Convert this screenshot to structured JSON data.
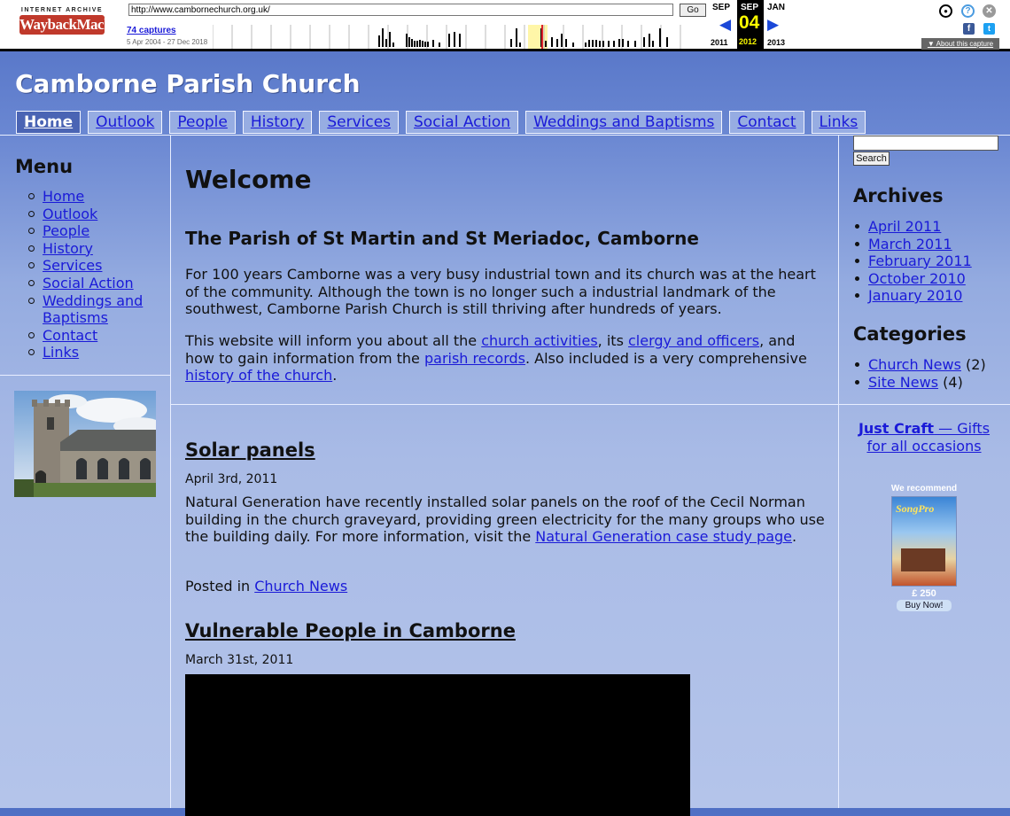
{
  "wayback": {
    "logo_top": "INTERNET ARCHIVE",
    "logo_main": "WaybackMachine",
    "url": "http://www.cambornechurch.org.uk/",
    "go_label": "Go",
    "captures": "74 captures",
    "range": "5 Apr 2004 - 27 Dec 2018",
    "prev_month": "SEP",
    "cur_month": "SEP",
    "next_month": "JAN",
    "cur_day": "04",
    "prev_year": "2011",
    "cur_year": "2012",
    "next_year": "2013",
    "about": "About this capture"
  },
  "site": {
    "title": "Camborne Parish Church"
  },
  "nav": [
    {
      "label": "Home",
      "active": true
    },
    {
      "label": "Outlook"
    },
    {
      "label": "People"
    },
    {
      "label": "History"
    },
    {
      "label": "Services"
    },
    {
      "label": "Social Action"
    },
    {
      "label": "Weddings and Baptisms"
    },
    {
      "label": "Contact"
    },
    {
      "label": "Links"
    }
  ],
  "menu": {
    "heading": "Menu",
    "items": [
      "Home",
      "Outlook",
      "People",
      "History",
      "Services",
      "Social Action",
      "Weddings and Baptisms",
      "Contact",
      "Links"
    ]
  },
  "main": {
    "heading": "Welcome",
    "subheading": "The Parish of St Martin and St Meriadoc, Camborne",
    "para1": "For 100 years Camborne was a very busy industrial town and its church was at the heart of the community. Although the town is no longer such a industrial landmark of the southwest, Camborne Parish Church is still thriving after hundreds of years.",
    "para2": {
      "t1": "This website will inform you about all the ",
      "l1": "church activities",
      "t2": ", its ",
      "l2": "clergy and officers",
      "t3": ", and how to gain information from the ",
      "l3": "parish records",
      "t4": ". Also included is a very comprehensive ",
      "l4": "history of the church",
      "t5": "."
    }
  },
  "posts": [
    {
      "title": "Solar panels",
      "date": "April 3rd, 2011",
      "body": "Natural Generation have recently installed solar panels on the roof of the Cecil Norman building in the church graveyard, providing green electricity for the many groups who use the building daily. For more information, visit the ",
      "link": "Natural Generation case study page",
      "after": ".",
      "posted_in": "Posted in ",
      "category": "Church News"
    },
    {
      "title": "Vulnerable People in Camborne",
      "date": "March 31st, 2011"
    }
  ],
  "sidebar": {
    "search_button": "Search",
    "archives_heading": "Archives",
    "archives": [
      "April 2011",
      "March 2011",
      "February 2011",
      "October 2010",
      "January 2010"
    ],
    "categories_heading": "Categories",
    "categories": [
      {
        "name": "Church News",
        "count": "(2)"
      },
      {
        "name": "Site News",
        "count": "(4)"
      }
    ],
    "ad_bold": "Just Craft",
    "ad_rest": " — Gifts for all occasions",
    "recommend": "We recommend",
    "book_title": "SongPro",
    "price": "£ 250",
    "buy": "Buy Now!"
  },
  "colors": {
    "link": "#1a1ad8",
    "nav_active": "#4a64b4",
    "toolbar_current": "#000000",
    "toolbar_day": "#ffff00"
  }
}
